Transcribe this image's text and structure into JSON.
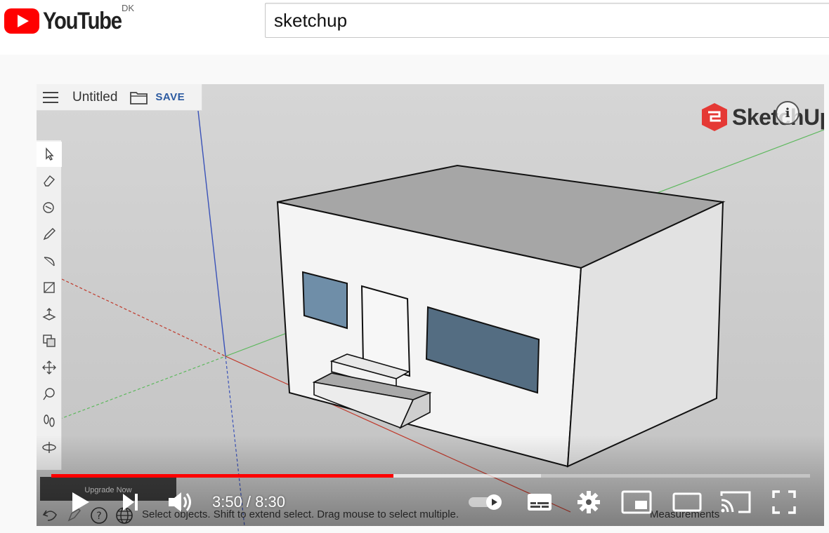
{
  "masthead": {
    "logo_text": "YouTube",
    "country_code": "DK",
    "search_value": "sketchup"
  },
  "sketchup": {
    "file_title": "Untitled",
    "save_label": "SAVE",
    "brand_text": "SketchUp",
    "upgrade_label": "Upgrade Now",
    "status_text": "Select objects. Shift to extend select. Drag mouse to select multiple.",
    "measurements_label": "Measurements",
    "tools": [
      "select-icon",
      "eraser-icon",
      "paint-bucket-icon",
      "pencil-icon",
      "arc-icon",
      "rectangle-icon",
      "push-pull-icon",
      "offset-icon",
      "move-icon",
      "tape-measure-icon",
      "footprints-icon",
      "orbit-icon"
    ]
  },
  "player": {
    "current_time": "3:50",
    "duration": "8:30",
    "time_display": "3:50 / 8:30",
    "progress_played": 0.451,
    "progress_buffered": 0.645,
    "autoplay": "on",
    "colors": {
      "played": "#ff0000",
      "logo": "#ff0000",
      "brand": "#e53935"
    }
  }
}
